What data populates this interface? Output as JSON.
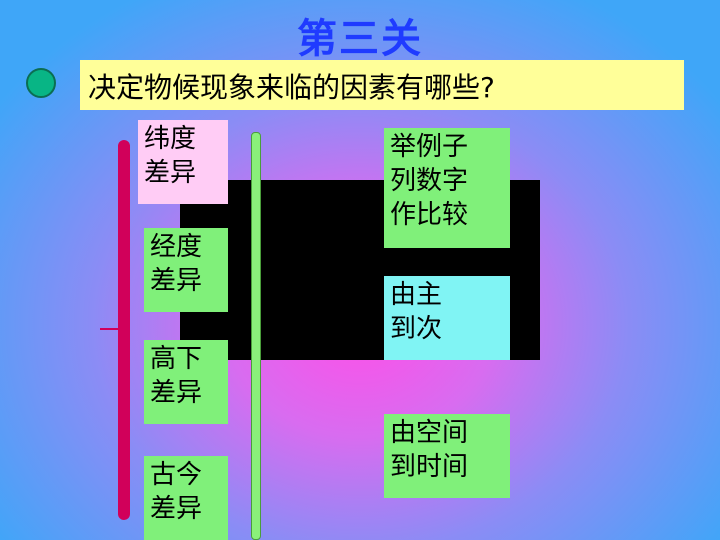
{
  "title": "第三关",
  "question": "决定物候现象来临的因素有哪些?",
  "left_boxes": [
    {
      "text": "纬度\n差异",
      "color": "#ffccf5"
    },
    {
      "text": "经度\n差异",
      "color": "#80f07a"
    },
    {
      "text": "高下\n差异",
      "color": "#80f07a"
    },
    {
      "text": "古今\n差异",
      "color": "#80f07a"
    }
  ],
  "right_boxes": [
    {
      "text": "举例子\n列数字\n作比较",
      "color": "#80f07a"
    },
    {
      "text": "由主\n到次",
      "color": "#80f4f4"
    },
    {
      "text": "由空间\n到时间",
      "color": "#80f07a"
    }
  ]
}
